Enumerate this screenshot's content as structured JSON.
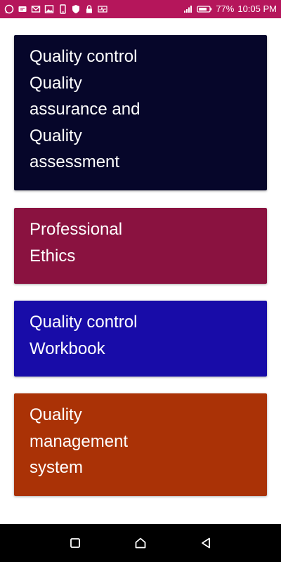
{
  "status_bar": {
    "battery": "77%",
    "time": "10:05 PM",
    "background": "#b5165b",
    "left_icons": [
      "whatsapp-icon",
      "message-icon",
      "email-icon",
      "image-icon",
      "phone-icon",
      "shield-icon",
      "lock-icon",
      "activity-icon"
    ],
    "right_icons": [
      "signal-icon",
      "battery-icon"
    ]
  },
  "cards": [
    {
      "title": "Quality control Quality assurance and Quality assessment",
      "color": "#06062a"
    },
    {
      "title": "Professional Ethics",
      "color": "#8a1240"
    },
    {
      "title": "Quality control Workbook",
      "color": "#180ca8"
    },
    {
      "title": "Quality management system",
      "color": "#aa3206"
    }
  ],
  "nav_bar": {
    "buttons": [
      "recents-icon",
      "home-icon",
      "back-icon"
    ]
  }
}
